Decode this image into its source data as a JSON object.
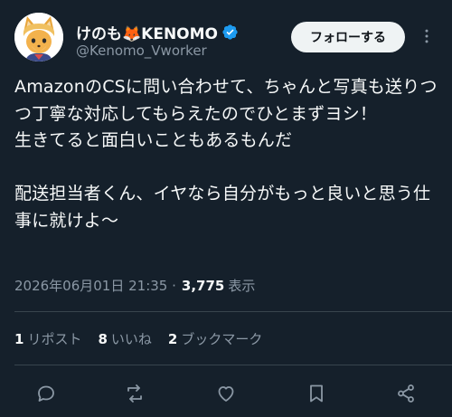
{
  "user": {
    "display_name": "けのも🦊KENOMO",
    "handle": "@Kenomo_Vworker",
    "verified": true,
    "avatar": "fox-avatar-icon"
  },
  "follow_button": {
    "label": "フォローする"
  },
  "more_button": {
    "icon": "more-icon"
  },
  "tweet": {
    "text": "AmazonのCSに問い合わせて、ちゃんと写真も送りつつ丁寧な対応してもらえたのでひとまずヨシ！\n生きてると面白いこともあるもんだ\n\n配送担当者くん、イヤなら自分がもっと良いと思う仕事に就けよ〜",
    "timestamp": "2026年06月01日 21:35 ·",
    "views_count": "3,775",
    "views_label": "表示"
  },
  "stats": {
    "reposts": {
      "count": "1",
      "label": "リポスト"
    },
    "likes": {
      "count": "8",
      "label": "いいね"
    },
    "bookmarks": {
      "count": "2",
      "label": "ブックマーク"
    }
  },
  "actions": [
    {
      "name": "reply",
      "icon": "reply-icon"
    },
    {
      "name": "repost",
      "icon": "repost-icon"
    },
    {
      "name": "like",
      "icon": "like-icon"
    },
    {
      "name": "bookmark",
      "icon": "bookmark-icon"
    },
    {
      "name": "share",
      "icon": "share-icon"
    }
  ],
  "colors": {
    "background": "#15202b",
    "text": "#f7f9f9",
    "secondary": "#8b98a5",
    "verified": "#1d9bf0",
    "divider": "#38444d",
    "follow_bg": "#eff3f4"
  }
}
